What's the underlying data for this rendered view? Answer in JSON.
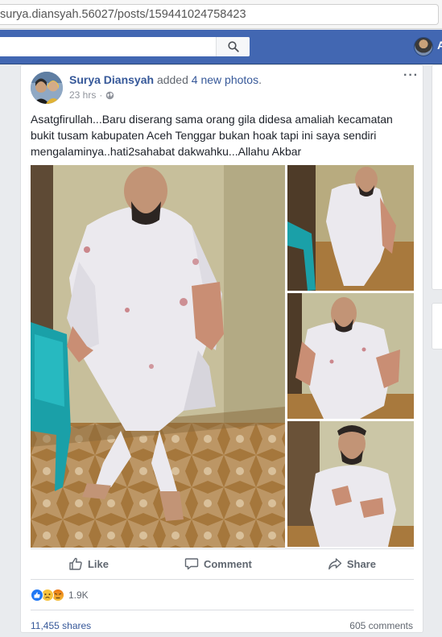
{
  "browser": {
    "url": "surya.diansyah.56027/posts/159441024758423"
  },
  "topbar": {
    "profile_initial": "A"
  },
  "post": {
    "author": "Surya Diansyah",
    "action": " added ",
    "photos_link": "4 new photos",
    "period": ".",
    "time": "23 hrs",
    "time_sep": "·",
    "text_line1": "Asatgfirullah...Baru diserang sama orang gila didesa amaliah kecamatan",
    "text_line2": "bukit tusam kabupaten Aceh Tenggar bukan hoak tapi ini saya sendiri",
    "text_line3": "mengalaminya..hati2sahabat dakwahku...Allahu Akbar"
  },
  "actions": {
    "like": "Like",
    "comment": "Comment",
    "share": "Share"
  },
  "stats": {
    "reactions": "1.9K",
    "shares": "11,455 shares",
    "comments": "605 comments"
  },
  "colors": {
    "fb_blue": "#4267b2",
    "link": "#365899",
    "like": "#2078f4",
    "angry": "#e9710f"
  }
}
